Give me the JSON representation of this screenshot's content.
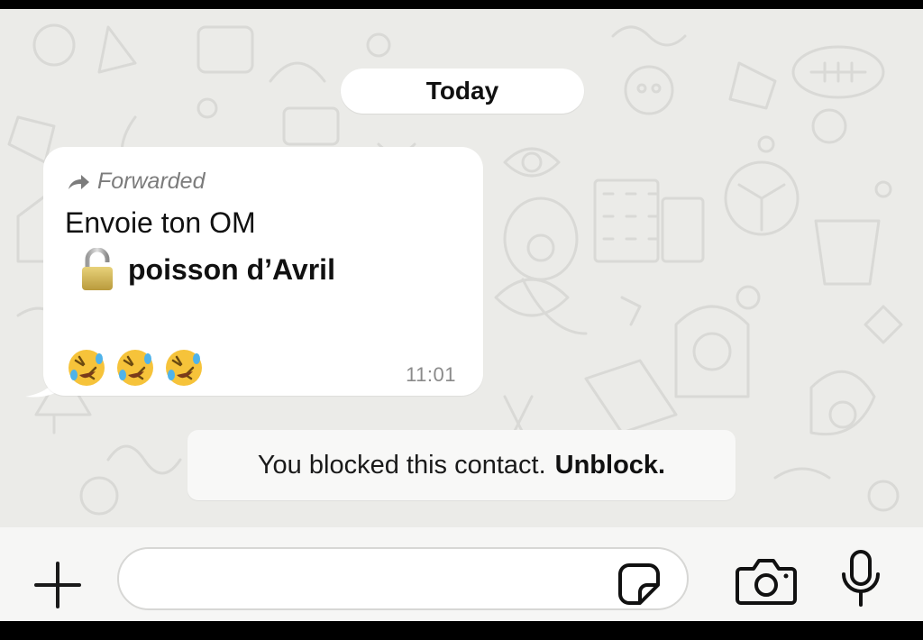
{
  "chat": {
    "date_separator": "Today",
    "message": {
      "forwarded_label": "Forwarded",
      "line1": "Envoie ton OM",
      "line2": "poisson d’Avril",
      "emojis": [
        "rolling-on-floor-laughing",
        "rolling-on-floor-laughing",
        "rolling-on-floor-laughing"
      ],
      "time": "11:01",
      "icons": [
        "forward-arrow-icon",
        "padlock-icon"
      ]
    },
    "system_notice": {
      "text": "You blocked this contact.",
      "action": "Unblock."
    }
  },
  "composer": {
    "input_value": "",
    "icons": [
      "plus-icon",
      "sticker-icon",
      "camera-icon",
      "microphone-icon"
    ]
  },
  "colors": {
    "wallpaper": "#ebebe8",
    "bubble": "#ffffff",
    "text": "#111111",
    "muted": "#8a8a8a",
    "emoji_face": "#f6c33a"
  }
}
